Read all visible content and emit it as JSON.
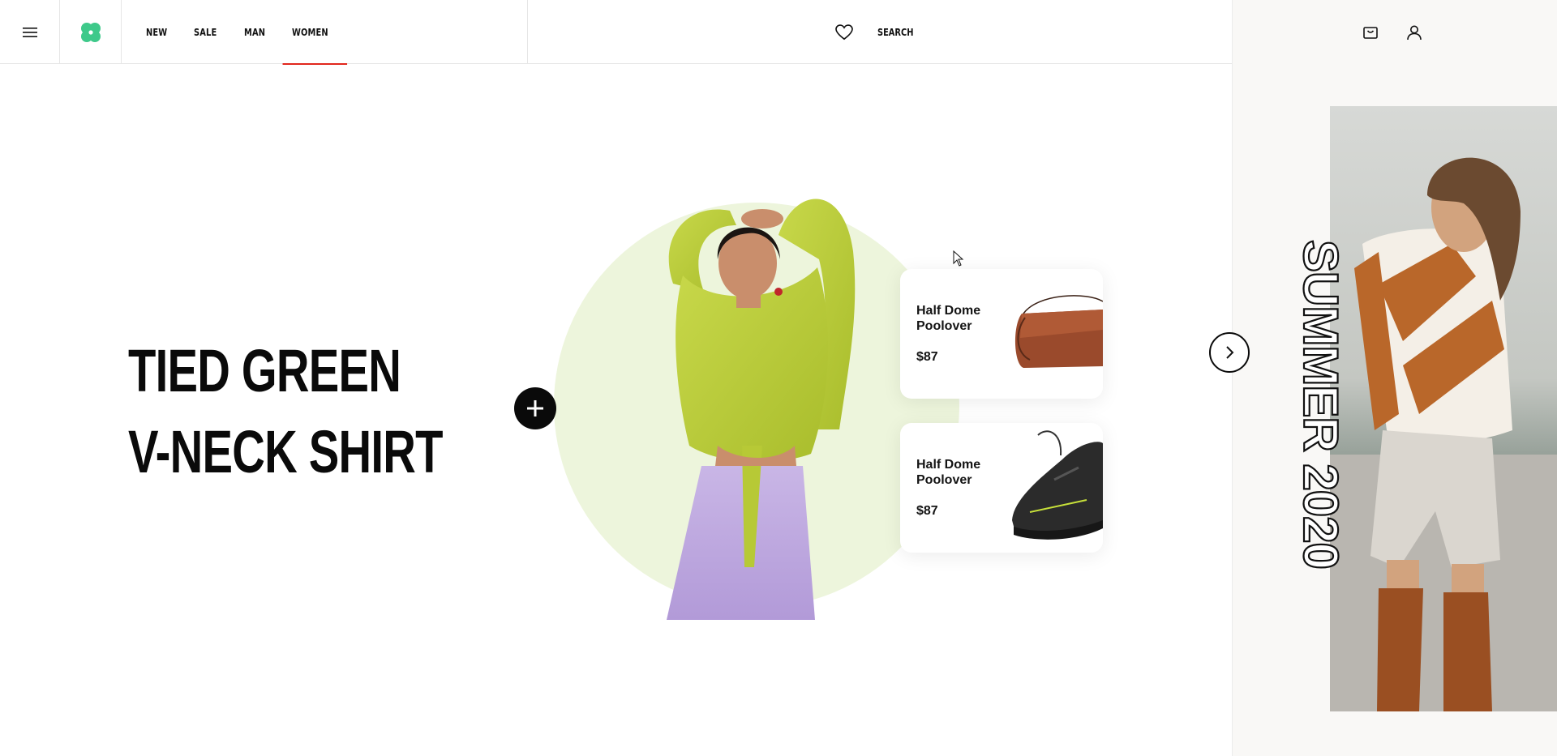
{
  "header": {
    "nav": [
      {
        "label": "NEW",
        "active": false
      },
      {
        "label": "SALE",
        "active": false
      },
      {
        "label": "MAN",
        "active": false
      },
      {
        "label": "WOMEN",
        "active": true
      }
    ],
    "search_label": "SEARCH",
    "icons": {
      "menu": "hamburger-menu-icon",
      "logo": "clover-logo",
      "wishlist": "heart-icon",
      "cart": "shopping-bag-icon",
      "account": "user-icon"
    },
    "active_underline_color": "#e1261c"
  },
  "hero": {
    "title_line1": "TIED GREEN",
    "title_line2": "V-NECK SHIRT",
    "circle_color": "#edf5dc",
    "add_icon": "plus-icon",
    "next_icon": "chevron-right-icon"
  },
  "products": [
    {
      "name": "Half Dome Poolover",
      "price": "$87",
      "image": "brown-leather-bag"
    },
    {
      "name": "Half Dome Poolover",
      "price": "$87",
      "image": "black-sneaker"
    }
  ],
  "side_banner": {
    "text": "SUMMER 2020"
  },
  "colors": {
    "logo_green": "#3ec98a",
    "accent_red": "#e1261c"
  }
}
